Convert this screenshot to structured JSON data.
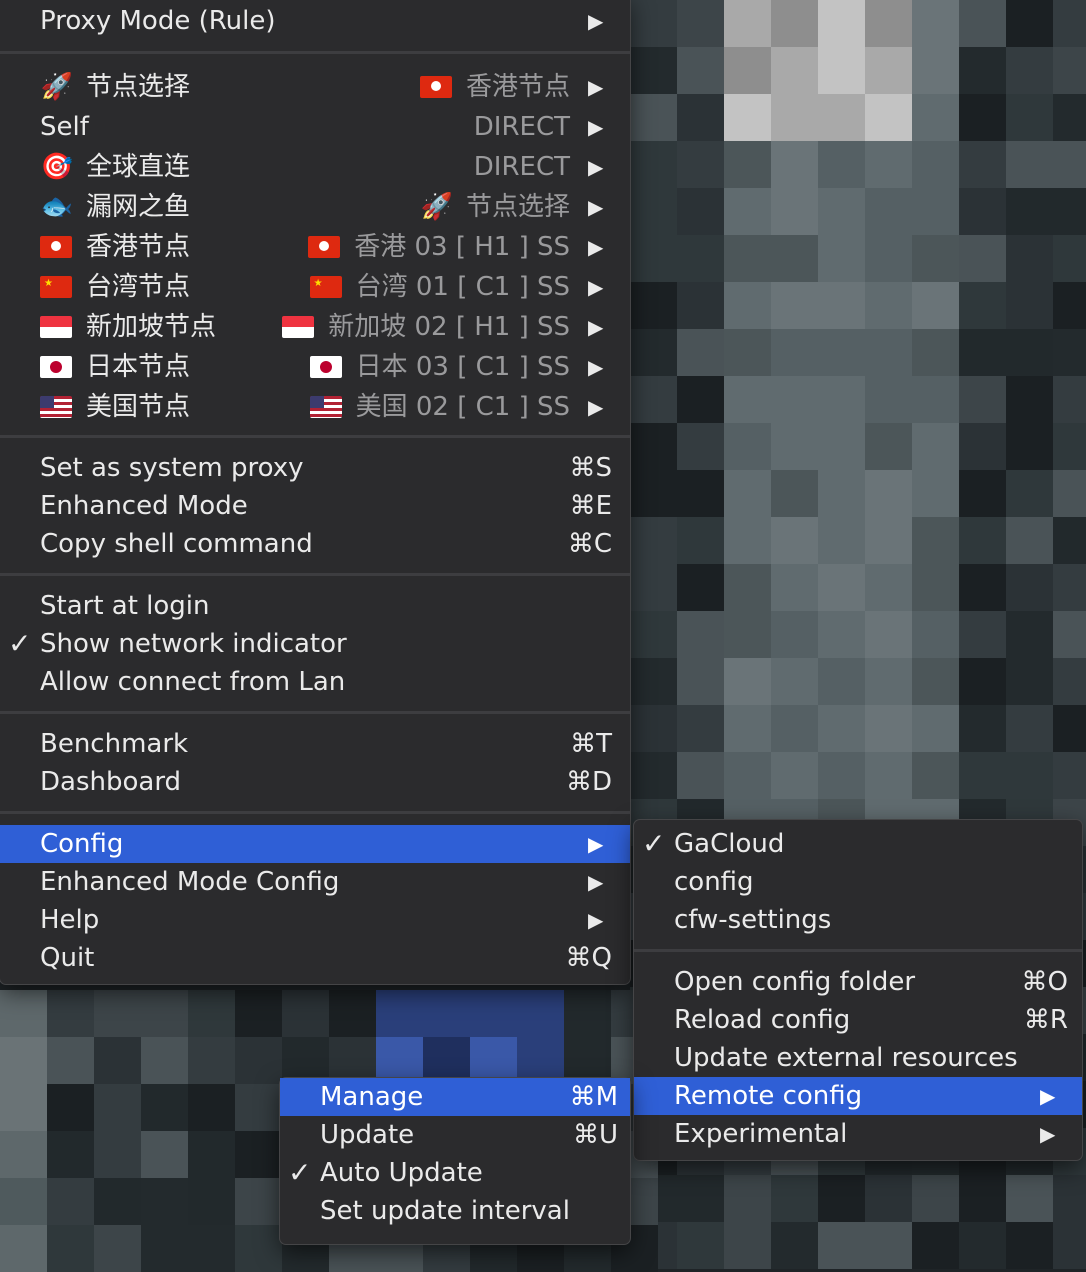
{
  "main_menu": {
    "proxy_mode": "Proxy Mode (Rule)",
    "groups": [
      {
        "icon": "rocket-icon",
        "emoji": "🚀",
        "name": "节点选择",
        "value_icon": "flag-hk-icon",
        "value_flag": "hk",
        "value": "香港节点"
      },
      {
        "icon": "",
        "emoji": "",
        "name": "Self",
        "value_icon": "",
        "value_flag": "",
        "value": "DIRECT"
      },
      {
        "icon": "target-icon",
        "emoji": "🎯",
        "name": "全球直连",
        "value_icon": "",
        "value_flag": "",
        "value": "DIRECT"
      },
      {
        "icon": "fish-icon",
        "emoji": "🐟",
        "name": "漏网之鱼",
        "value_icon": "rocket-icon",
        "value_emoji": "🚀",
        "value_flag": "",
        "value": "节点选择"
      },
      {
        "icon": "flag-hk-icon",
        "flag": "hk",
        "name": "香港节点",
        "value_icon": "flag-hk-icon",
        "value_flag": "hk",
        "value": "香港 03 [ H1 ] SS"
      },
      {
        "icon": "flag-cn-icon",
        "flag": "cn",
        "name": "台湾节点",
        "value_icon": "flag-cn-icon",
        "value_flag": "cn",
        "value": "台湾 01 [ C1 ] SS"
      },
      {
        "icon": "flag-sg-icon",
        "flag": "sg",
        "name": "新加坡节点",
        "value_icon": "flag-sg-icon",
        "value_flag": "sg",
        "value": "新加坡 02 [ H1 ] SS"
      },
      {
        "icon": "flag-jp-icon",
        "flag": "jp",
        "name": "日本节点",
        "value_icon": "flag-jp-icon",
        "value_flag": "jp",
        "value": "日本 03 [ C1 ] SS"
      },
      {
        "icon": "flag-us-icon",
        "flag": "us",
        "name": "美国节点",
        "value_icon": "flag-us-icon",
        "value_flag": "us",
        "value": "美国 02 [ C1 ] SS"
      }
    ],
    "system_proxy": {
      "label": "Set as system proxy",
      "shortcut": "⌘S"
    },
    "enhanced_mode": {
      "label": "Enhanced Mode",
      "shortcut": "⌘E"
    },
    "copy_shell": {
      "label": "Copy shell command",
      "shortcut": "⌘C"
    },
    "start_login": {
      "label": "Start at login"
    },
    "network_indicator": {
      "label": "Show network indicator",
      "checked": true
    },
    "allow_lan": {
      "label": "Allow connect from Lan"
    },
    "benchmark": {
      "label": "Benchmark",
      "shortcut": "⌘T"
    },
    "dashboard": {
      "label": "Dashboard",
      "shortcut": "⌘D"
    },
    "config": {
      "label": "Config"
    },
    "enhanced_config": {
      "label": "Enhanced Mode Config"
    },
    "help": {
      "label": "Help"
    },
    "quit": {
      "label": "Quit",
      "shortcut": "⌘Q"
    }
  },
  "config_menu": {
    "profiles": [
      {
        "label": "GaCloud",
        "checked": true
      },
      {
        "label": "config",
        "checked": false
      },
      {
        "label": "cfw-settings",
        "checked": false
      }
    ],
    "open_folder": {
      "label": "Open config folder",
      "shortcut": "⌘O"
    },
    "reload": {
      "label": "Reload config",
      "shortcut": "⌘R"
    },
    "update_external": {
      "label": "Update external resources"
    },
    "remote_config": {
      "label": "Remote config"
    },
    "experimental": {
      "label": "Experimental"
    }
  },
  "remote_menu": {
    "manage": {
      "label": "Manage",
      "shortcut": "⌘M"
    },
    "update": {
      "label": "Update",
      "shortcut": "⌘U"
    },
    "auto_update": {
      "label": "Auto Update",
      "checked": true
    },
    "interval": {
      "label": "Set update interval"
    }
  },
  "glyphs": {
    "arrow": "▶",
    "check": "✓"
  },
  "colors": {
    "highlight": "#2f5fd6",
    "menu_bg": "#2b2b2d",
    "secondary_text": "#9a9a9c"
  }
}
